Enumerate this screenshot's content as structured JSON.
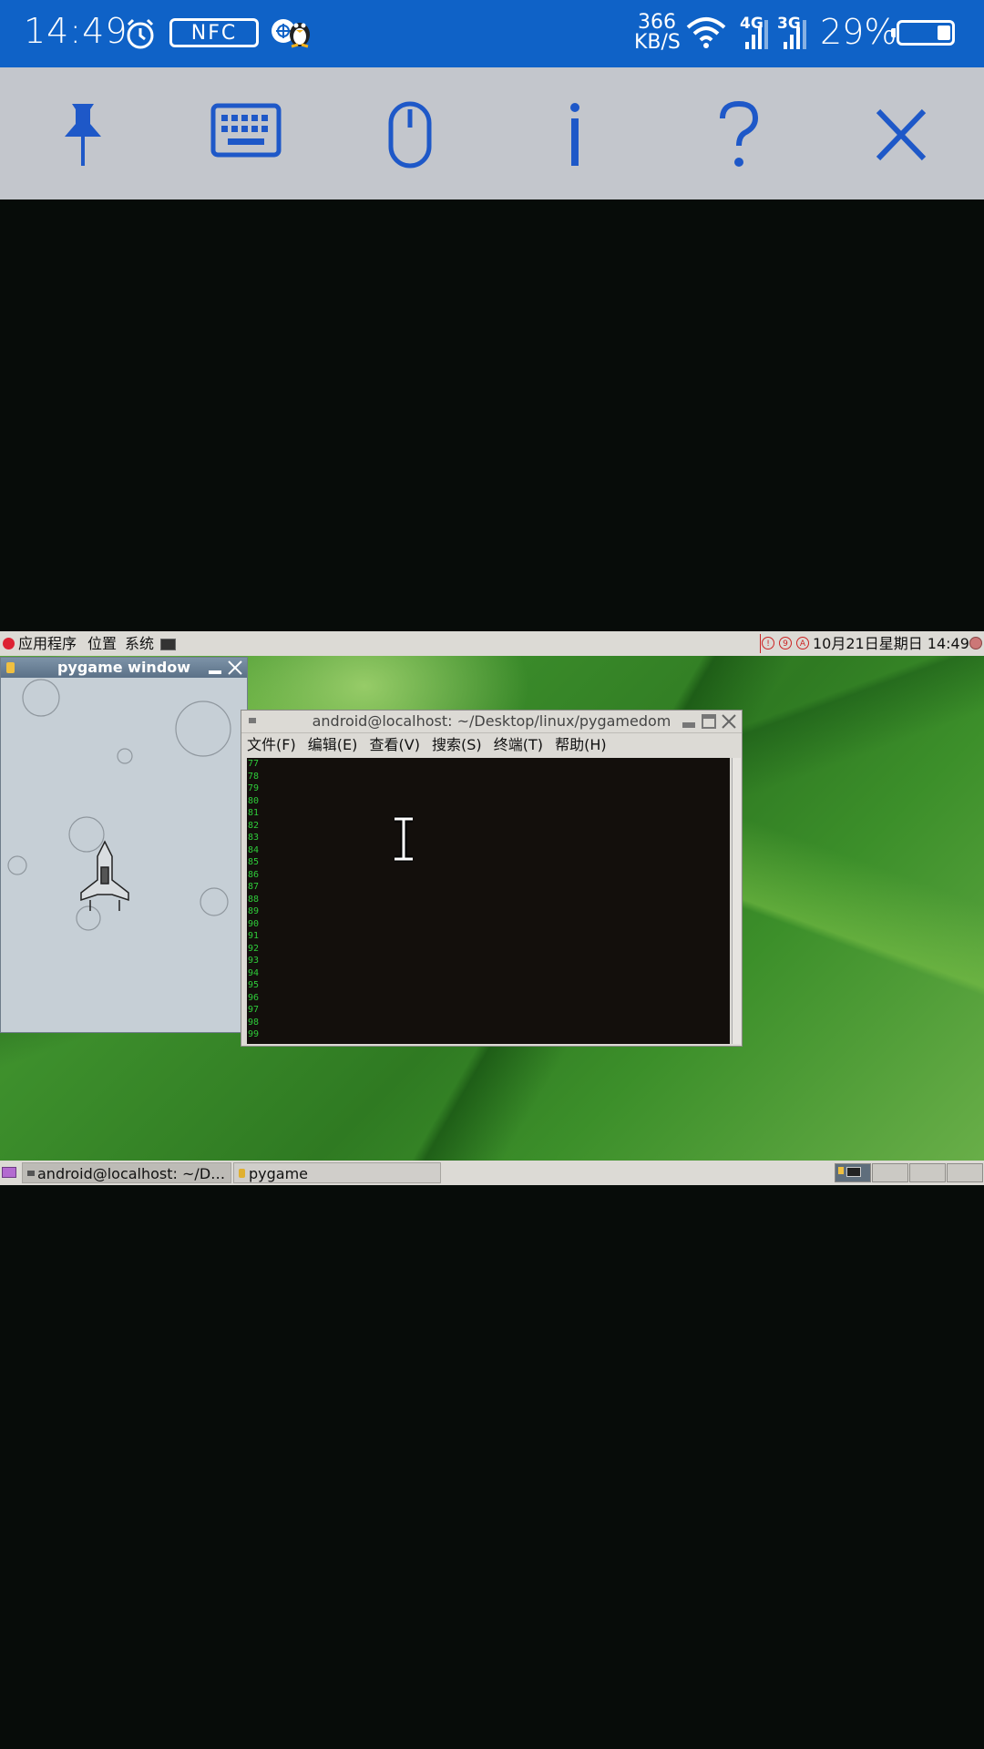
{
  "status_bar": {
    "time": "14:49",
    "nfc_label": "NFC",
    "net_speed_value": "366",
    "net_speed_unit": "KB/S",
    "signal_1_label": "4G",
    "signal_2_label": "3G",
    "battery_percent": "29%",
    "battery_level": 0.29,
    "icons": [
      "alarm-icon",
      "nfc-icon",
      "app-icon",
      "qq-penguin-icon",
      "wifi-icon",
      "signal-icon",
      "battery-icon"
    ]
  },
  "toolbar": {
    "buttons": [
      "pin-icon",
      "keyboard-icon",
      "mouse-icon",
      "info-icon",
      "help-icon",
      "close-icon"
    ]
  },
  "desktop": {
    "top_panel": {
      "menu_apps": "应用程序",
      "menu_places": "位置",
      "menu_system": "系统",
      "clock": "10月21日星期日 14:49"
    },
    "pygame_window": {
      "title": "pygame window"
    },
    "terminal_window": {
      "title": "android@localhost: ~/Desktop/linux/pygamedom",
      "menu": [
        "文件(F)",
        "编辑(E)",
        "查看(V)",
        "搜索(S)",
        "终端(T)",
        "帮助(H)"
      ],
      "lines": [
        "77",
        "78",
        "79",
        "80",
        "81",
        "82",
        "83",
        "84",
        "85",
        "86",
        "87",
        "88",
        "89",
        "90",
        "91",
        "92",
        "93",
        "94",
        "95",
        "96",
        "97",
        "98",
        "99"
      ]
    },
    "bottom_panel": {
      "task_terminal": "android@localhost: ~/D…",
      "task_pygame": "pygame"
    }
  },
  "colors": {
    "status_bar": "#0f62c7",
    "toolbar": "#c3c6cc",
    "toolbar_icon": "#1e58c8",
    "terminal_text": "#2ecc3a"
  }
}
